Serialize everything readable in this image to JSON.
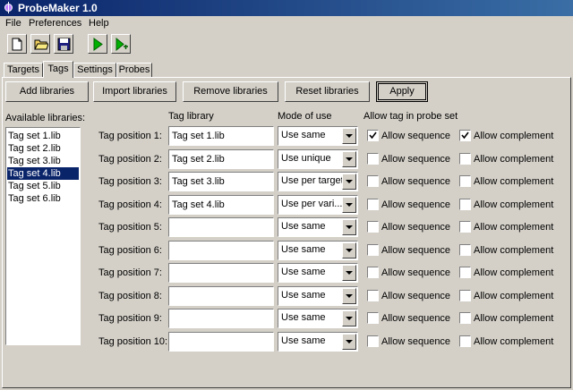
{
  "window": {
    "title": "ProbeMaker 1.0",
    "app_icon": "probe-icon"
  },
  "menu": [
    "File",
    "Preferences",
    "Help"
  ],
  "toolbar": [
    "new-file-icon",
    "open-folder-icon",
    "save-disk-icon",
    "run-icon",
    "run-step-icon"
  ],
  "tabs": [
    {
      "label": "Targets",
      "active": false
    },
    {
      "label": "Tags",
      "active": true
    },
    {
      "label": "Settings",
      "active": false
    },
    {
      "label": "Probes",
      "active": false
    }
  ],
  "actions": {
    "add": "Add libraries",
    "import": "Import libraries",
    "remove": "Remove libraries",
    "reset": "Reset libraries",
    "apply": "Apply"
  },
  "libraries": {
    "label": "Available libraries:",
    "items": [
      "Tag set 1.lib",
      "Tag set 2.lib",
      "Tag set 3.lib",
      "Tag set 4.lib",
      "Tag set 5.lib",
      "Tag set 6.lib"
    ],
    "selected_index": 3
  },
  "headers": {
    "tag_library": "Tag library",
    "mode": "Mode of use",
    "allow": "Allow tag in probe set"
  },
  "check_labels": {
    "sequence": "Allow sequence",
    "complement": "Allow complement"
  },
  "rows": [
    {
      "label": "Tag position 1:",
      "library": "Tag set 1.lib",
      "mode": "Use same",
      "seq": true,
      "comp": true
    },
    {
      "label": "Tag position 2:",
      "library": "Tag set 2.lib",
      "mode": "Use unique",
      "seq": false,
      "comp": false
    },
    {
      "label": "Tag position 3:",
      "library": "Tag set 3.lib",
      "mode": "Use per target",
      "seq": false,
      "comp": false
    },
    {
      "label": "Tag position 4:",
      "library": "Tag set 4.lib",
      "mode": "Use per vari...",
      "seq": false,
      "comp": false
    },
    {
      "label": "Tag position 5:",
      "library": "",
      "mode": "Use same",
      "seq": false,
      "comp": false
    },
    {
      "label": "Tag position 6:",
      "library": "",
      "mode": "Use same",
      "seq": false,
      "comp": false
    },
    {
      "label": "Tag position 7:",
      "library": "",
      "mode": "Use same",
      "seq": false,
      "comp": false
    },
    {
      "label": "Tag position 8:",
      "library": "",
      "mode": "Use same",
      "seq": false,
      "comp": false
    },
    {
      "label": "Tag position 9:",
      "library": "",
      "mode": "Use same",
      "seq": false,
      "comp": false
    },
    {
      "label": "Tag position 10:",
      "library": "",
      "mode": "Use same",
      "seq": false,
      "comp": false
    }
  ]
}
